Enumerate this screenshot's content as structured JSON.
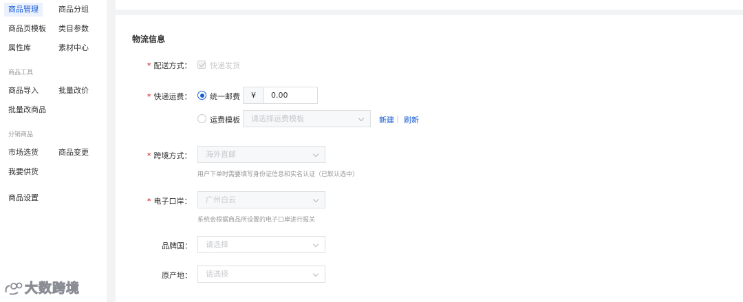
{
  "sidebar": {
    "items": [
      {
        "label": "商品管理",
        "active": true
      },
      {
        "label": "商品分组"
      },
      {
        "label": "商品页模板"
      },
      {
        "label": "类目参数"
      },
      {
        "label": "属性库"
      },
      {
        "label": "素材中心"
      },
      {
        "label": "商品导入"
      },
      {
        "label": "批量改价"
      },
      {
        "label": "批量改商品"
      },
      {
        "label": "市场选货"
      },
      {
        "label": "商品变更"
      },
      {
        "label": "我要供货"
      },
      {
        "label": "商品设置"
      }
    ],
    "groups": [
      "商品工具",
      "分销商品"
    ],
    "watermark": "大数跨境"
  },
  "section": {
    "title": "物流信息"
  },
  "delivery": {
    "label": "配送方式：",
    "option": "快递发货",
    "checked": true
  },
  "freight": {
    "label": "快递运费：",
    "unified_label": "统一邮费",
    "currency": "¥",
    "amount": "0.00",
    "template_label": "运费模板",
    "template_placeholder": "请选择运费模板",
    "new_link": "新建",
    "divider": "|",
    "refresh_link": "刷新"
  },
  "crossborder": {
    "label": "跨境方式：",
    "value": "海外直邮",
    "hint": "用户下单时需要填写身份证信息和实名认证（已默认选中）"
  },
  "eport": {
    "label": "电子口岸：",
    "value": "广州白云",
    "hint": "系统会根据商品所设置的电子口岸进行报关"
  },
  "brand_country": {
    "label": "品牌国：",
    "placeholder": "请选择"
  },
  "origin": {
    "label": "原产地：",
    "placeholder": "请选择"
  },
  "colors": {
    "accent": "#155bd4",
    "required": "#d40000"
  }
}
